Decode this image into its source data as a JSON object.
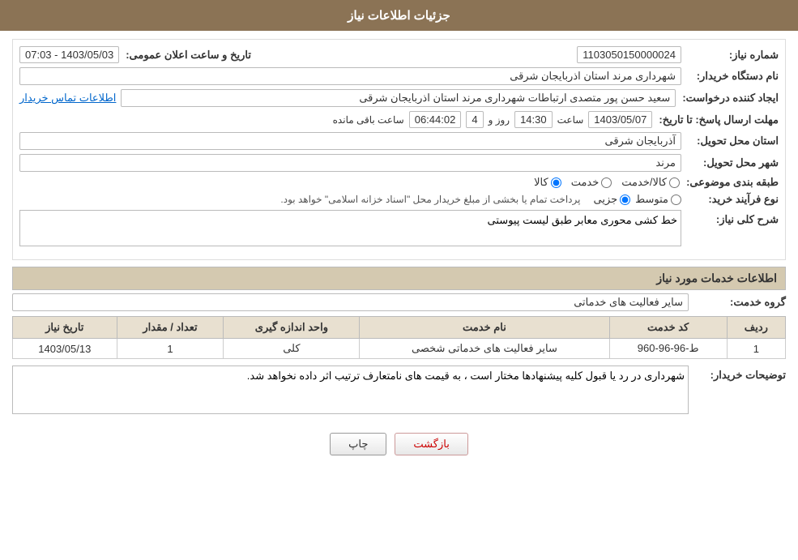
{
  "header": {
    "title": "جزئیات اطلاعات نیاز"
  },
  "fields": {
    "need_number_label": "شماره نیاز:",
    "need_number_value": "1103050150000024",
    "announce_label": "تاریخ و ساعت اعلان عمومی:",
    "announce_value": "1403/05/03 - 07:03",
    "buyer_org_label": "نام دستگاه خریدار:",
    "buyer_org_value": "شهرداری مرند استان اذربایجان شرقی",
    "creator_label": "ایجاد کننده درخواست:",
    "creator_value": "سعید حسن پور متصدی ارتباطات شهرداری مرند استان اذربایجان شرقی",
    "contact_link": "اطلاعات تماس خریدار",
    "response_deadline_label": "مهلت ارسال پاسخ: تا تاریخ:",
    "response_date": "1403/05/07",
    "response_time_label": "ساعت",
    "response_time": "14:30",
    "response_days_label": "روز و",
    "response_days": "4",
    "response_remaining_label": "ساعت باقی مانده",
    "response_remaining": "06:44:02",
    "province_label": "استان محل تحویل:",
    "province_value": "آذربایجان شرقی",
    "city_label": "شهر محل تحویل:",
    "city_value": "مرند",
    "category_label": "طبقه بندی موضوعی:",
    "category_options": [
      "کالا",
      "خدمت",
      "کالا/خدمت"
    ],
    "category_selected": "کالا",
    "purchase_type_label": "نوع فرآیند خرید:",
    "purchase_options": [
      "جزیی",
      "متوسط"
    ],
    "purchase_note": "پرداخت تمام یا بخشی از مبلغ خریدار محل \"اسناد خزانه اسلامی\" خواهد بود.",
    "need_description_label": "شرح کلی نیاز:",
    "need_description_value": "خط کشی محوری معابر طبق لیست پیوستی",
    "services_section_label": "اطلاعات خدمات مورد نیاز",
    "service_group_label": "گروه خدمت:",
    "service_group_value": "سایر فعالیت های خدماتی",
    "table": {
      "headers": [
        "ردیف",
        "کد خدمت",
        "نام خدمت",
        "واحد اندازه گیری",
        "تعداد / مقدار",
        "تاریخ نیاز"
      ],
      "rows": [
        {
          "row": "1",
          "code": "ط-96-96-960",
          "name": "سایر فعالیت های خدماتی شخصی",
          "unit": "کلی",
          "quantity": "1",
          "date": "1403/05/13"
        }
      ]
    },
    "buyer_notes_label": "توضیحات خریدار:",
    "buyer_notes_value": "شهرداری در رد یا قبول کلیه پیشنهادها مختار است ، به قیمت های نامتعارف ترتیب اثر داده نخواهد شد.",
    "print_button": "چاپ",
    "back_button": "بازگشت"
  }
}
